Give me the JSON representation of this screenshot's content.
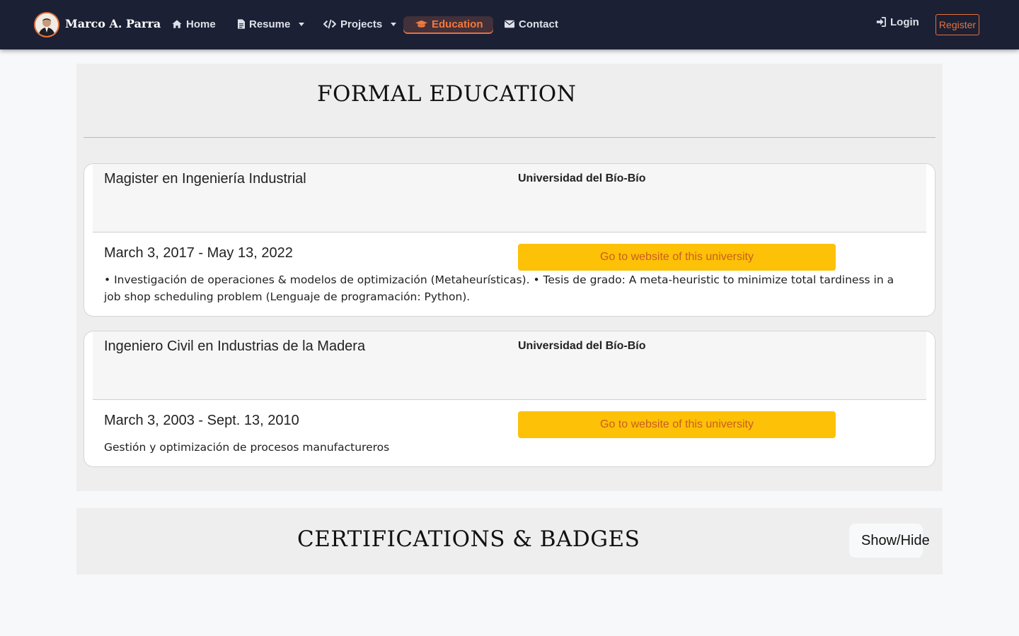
{
  "navbar": {
    "brand": "Marco A. Parra",
    "items": [
      {
        "label": "Home",
        "icon": "home-icon",
        "dropdown": false,
        "active": false
      },
      {
        "label": "Resume",
        "icon": "file-icon",
        "dropdown": true,
        "active": false
      },
      {
        "label": "Projects",
        "icon": "code-icon",
        "dropdown": true,
        "active": false
      },
      {
        "label": "Education",
        "icon": "graduation-cap-icon",
        "dropdown": false,
        "active": true
      },
      {
        "label": "Contact",
        "icon": "envelope-icon",
        "dropdown": false,
        "active": false
      }
    ],
    "login": "Login",
    "register": "Register"
  },
  "education": {
    "title": "FORMAL EDUCATION",
    "entries": [
      {
        "degree": "Magister en Ingeniería Industrial",
        "university": "Universidad del Bío-Bío",
        "dates": "March 3, 2017 - May 13, 2022",
        "button": "Go to website of this university",
        "description": "• Investigación de operaciones & modelos de optimización (Metaheurísticas). • Tesis de grado: A meta-heuristic to minimize total tardiness in a job shop scheduling problem (Lenguaje de programación: Python)."
      },
      {
        "degree": "Ingeniero Civil en Industrias de la Madera",
        "university": "Universidad del Bío-Bío",
        "dates": "March 3, 2003 - Sept. 13, 2010",
        "button": "Go to website of this university",
        "description": "Gestión y optimización de procesos manufactureros"
      }
    ]
  },
  "certifications": {
    "title": "CERTIFICATIONS & BADGES",
    "toggle": "Show/Hide"
  },
  "colors": {
    "navbar_bg": "#1b2034",
    "accent": "#e8703a",
    "button_bg": "#fdc107",
    "section_bg": "#eeeeee",
    "page_bg": "#f7f8fa"
  }
}
